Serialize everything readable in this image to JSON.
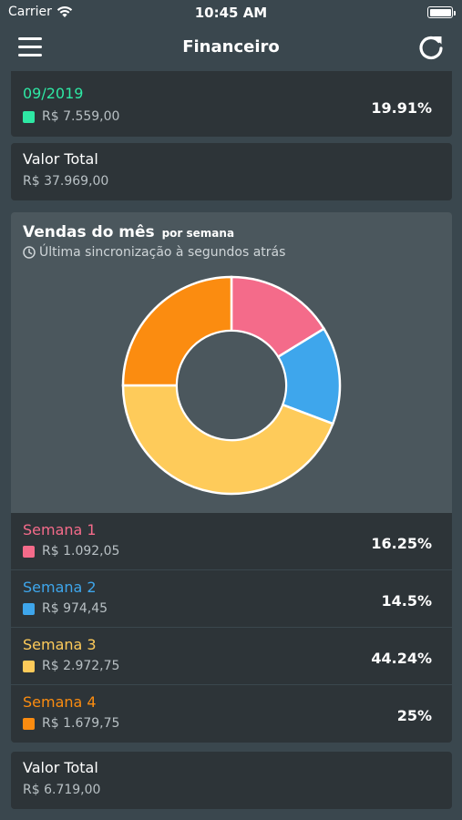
{
  "status_bar": {
    "carrier": "Carrier",
    "time": "10:45 AM"
  },
  "nav": {
    "title": "Financeiro"
  },
  "top_item": {
    "label": "09/2019",
    "value": "R$ 7.559,00",
    "percent": "19.91%",
    "color": "#2ee8a4"
  },
  "total_top": {
    "label": "Valor Total",
    "value": "R$ 37.969,00"
  },
  "chart_panel": {
    "title": "Vendas do mês",
    "subtitle": "por semana",
    "sync_text": "Última sincronização à segundos atrás"
  },
  "chart_data": {
    "type": "pie",
    "categories": [
      "Semana 1",
      "Semana 2",
      "Semana 3",
      "Semana 4"
    ],
    "values": [
      16.25,
      14.5,
      44.24,
      25
    ],
    "colors": [
      "#f46b8a",
      "#3ea6ec",
      "#fecb5a",
      "#fb8c10"
    ],
    "donut": true
  },
  "weeks": [
    {
      "label": "Semana 1",
      "value": "R$ 1.092,05",
      "percent": "16.25%",
      "color": "#f46b8a"
    },
    {
      "label": "Semana 2",
      "value": "R$ 974,45",
      "percent": "14.5%",
      "color": "#3ea6ec"
    },
    {
      "label": "Semana 3",
      "value": "R$ 2.972,75",
      "percent": "44.24%",
      "color": "#fecb5a"
    },
    {
      "label": "Semana 4",
      "value": "R$ 1.679,75",
      "percent": "25%",
      "color": "#fb8c10"
    }
  ],
  "total_bottom": {
    "label": "Valor Total",
    "value": "R$ 6.719,00"
  },
  "icons": {
    "menu": "hamburger-icon",
    "refresh": "refresh-icon",
    "sync": "clock-icon",
    "wifi": "wifi-icon",
    "battery": "battery-icon"
  }
}
